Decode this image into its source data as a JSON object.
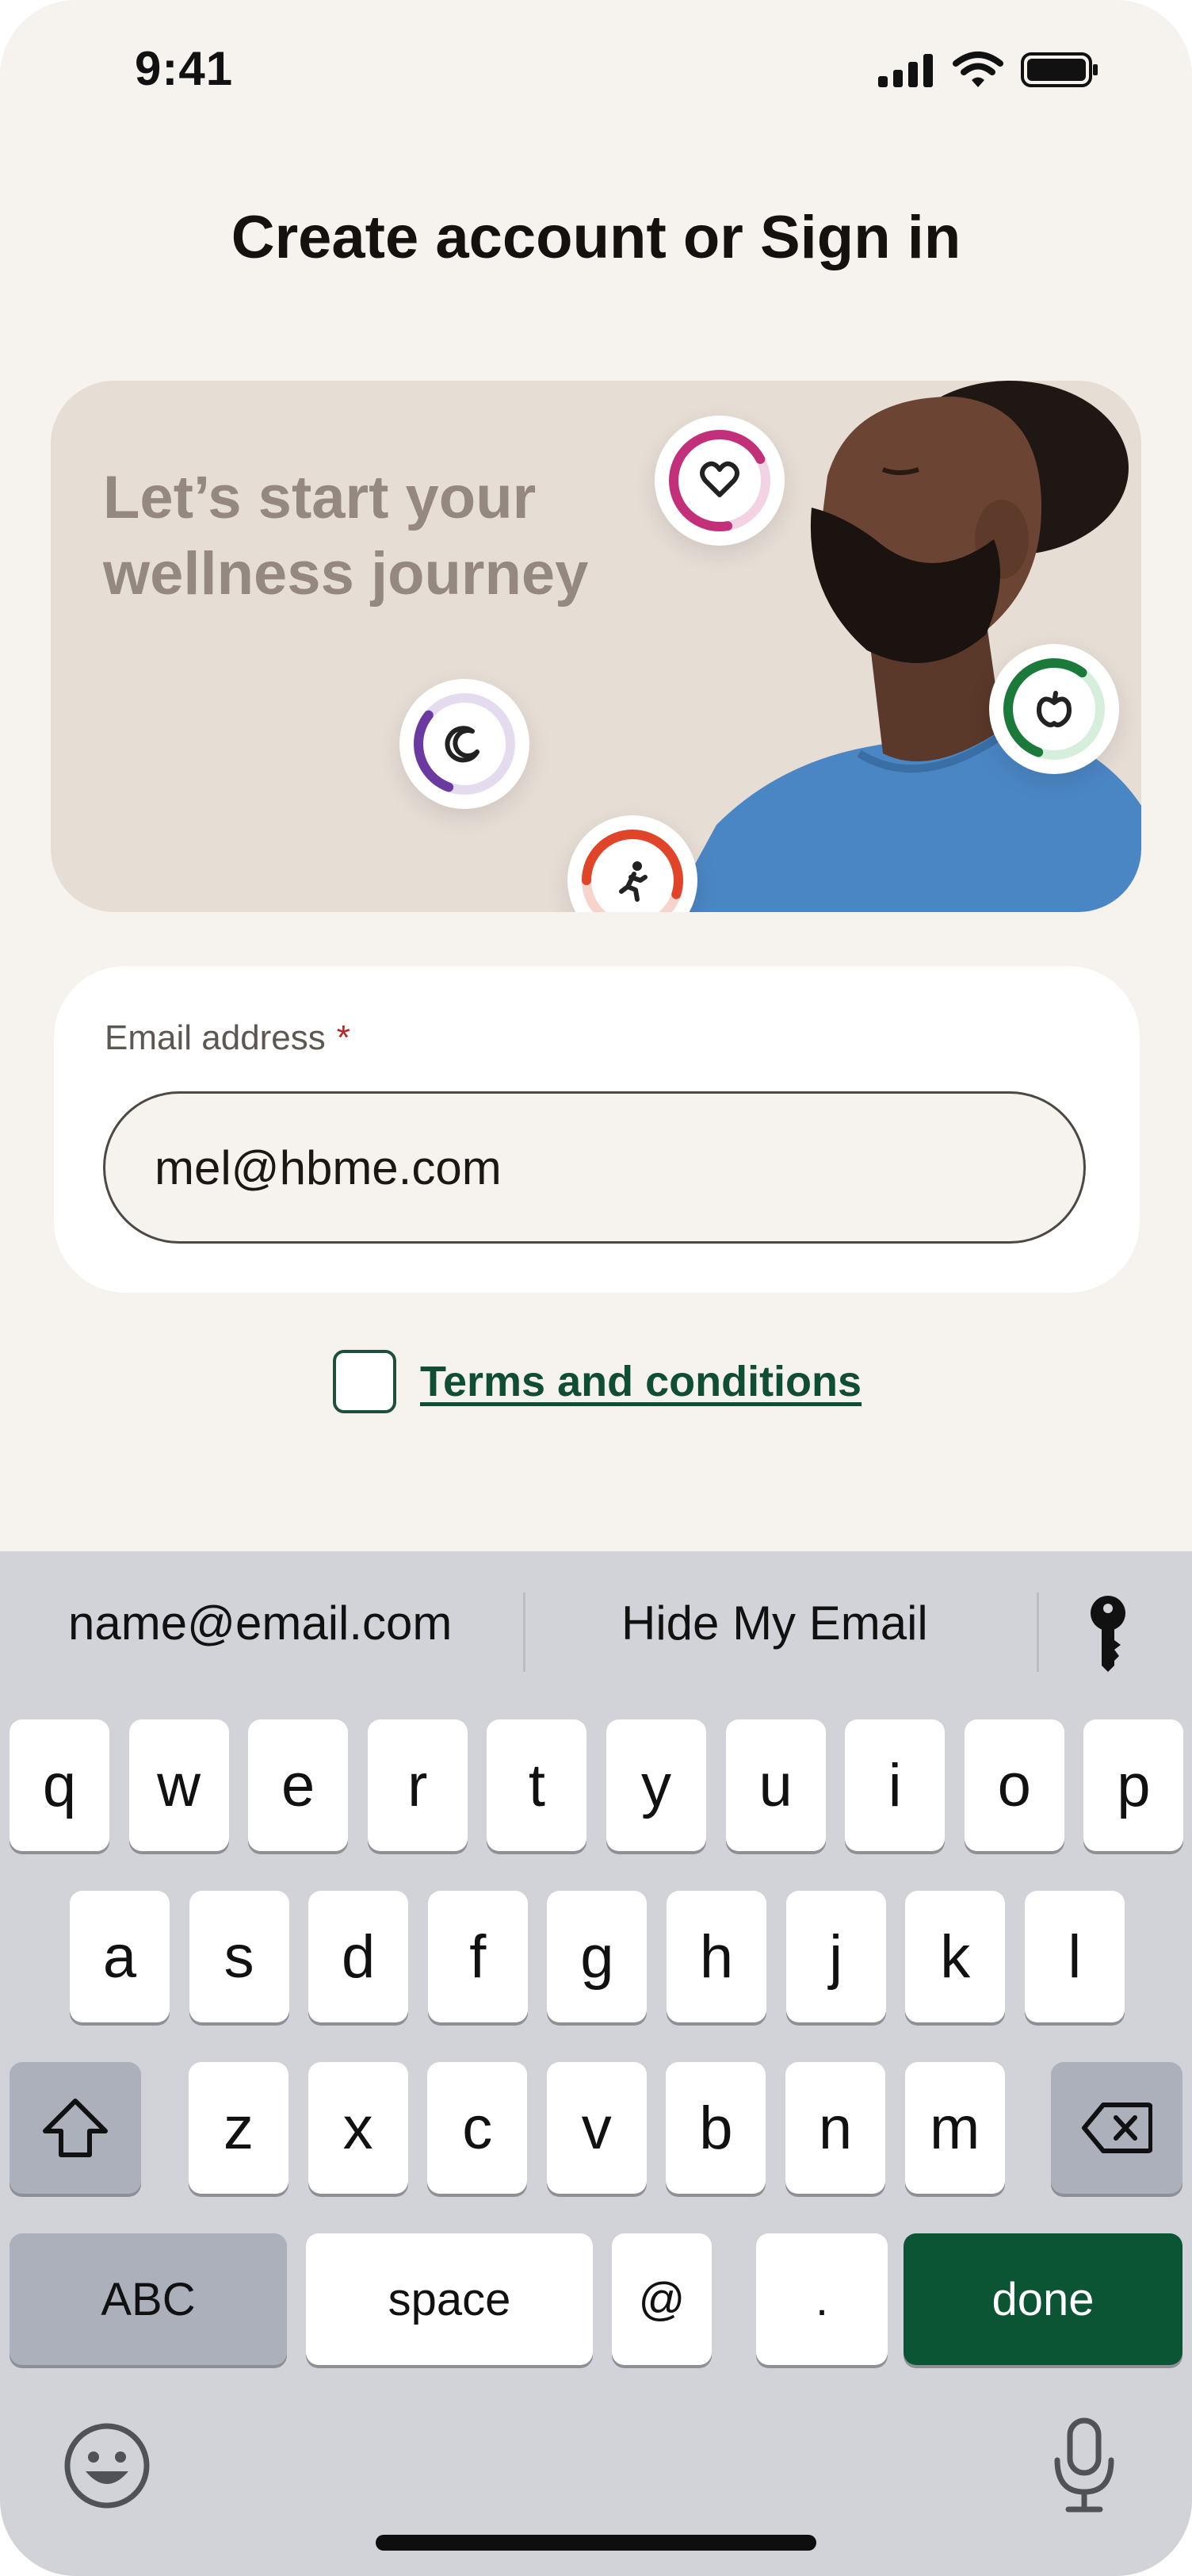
{
  "status_bar": {
    "time": "9:41"
  },
  "page": {
    "title": "Create account or Sign in"
  },
  "hero": {
    "headline": "Let’s start your wellness journey",
    "rings": [
      {
        "icon": "heart-icon",
        "color": "#c2307a",
        "track": "#f3d3e3",
        "progress": 0.7
      },
      {
        "icon": "moon-icon",
        "color": "#6b3aa0",
        "track": "#e4dbef",
        "progress": 0.3
      },
      {
        "icon": "apple-icon",
        "color": "#1b7a3a",
        "track": "#d6efdc",
        "progress": 0.6
      },
      {
        "icon": "runner-icon",
        "color": "#e0452a",
        "track": "#f7d4cb",
        "progress": 0.55
      }
    ]
  },
  "email": {
    "label": "Email address",
    "required_marker": "*",
    "value": "mel@hbme.com"
  },
  "terms": {
    "label": "Terms and conditions",
    "checked": false
  },
  "keyboard": {
    "suggestions": [
      "name@email.com",
      "Hide My Email"
    ],
    "row1": [
      "q",
      "w",
      "e",
      "r",
      "t",
      "y",
      "u",
      "i",
      "o",
      "p"
    ],
    "row2": [
      "a",
      "s",
      "d",
      "f",
      "g",
      "h",
      "j",
      "k",
      "l"
    ],
    "row3": [
      "z",
      "x",
      "c",
      "v",
      "b",
      "n",
      "m"
    ],
    "abc_label": "ABC",
    "space_label": "space",
    "at_label": "@",
    "dot_label": ".",
    "done_label": "done"
  },
  "colors": {
    "background": "#f6f2ee",
    "brand_green": "#0b5535",
    "hero_bg": "#e6ddd5"
  }
}
